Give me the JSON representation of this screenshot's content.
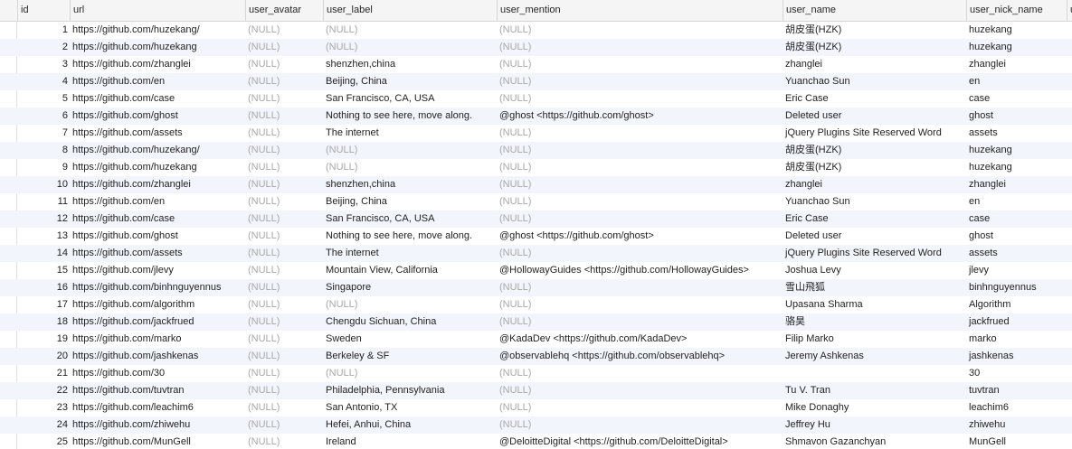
{
  "columns": [
    {
      "key": "id",
      "label": "id"
    },
    {
      "key": "url",
      "label": "url"
    },
    {
      "key": "user_avatar",
      "label": "user_avatar"
    },
    {
      "key": "user_label",
      "label": "user_label"
    },
    {
      "key": "user_mention",
      "label": "user_mention"
    },
    {
      "key": "user_name",
      "label": "user_name"
    },
    {
      "key": "user_nick_name",
      "label": "user_nick_name"
    },
    {
      "key": "extra",
      "label": "u"
    }
  ],
  "null_text": "(NULL)",
  "rows": [
    {
      "id": "1",
      "url": "https://github.com/huzekang/",
      "user_avatar": null,
      "user_label": null,
      "user_mention": null,
      "user_name": "胡皮蛋(HZK)",
      "user_nick_name": "huzekang"
    },
    {
      "id": "2",
      "url": "https://github.com/huzekang",
      "user_avatar": null,
      "user_label": null,
      "user_mention": null,
      "user_name": "胡皮蛋(HZK)",
      "user_nick_name": "huzekang"
    },
    {
      "id": "3",
      "url": "https://github.com/zhanglei",
      "user_avatar": null,
      "user_label": "shenzhen,china",
      "user_mention": null,
      "user_name": "zhanglei",
      "user_nick_name": "zhanglei"
    },
    {
      "id": "4",
      "url": "https://github.com/en",
      "user_avatar": null,
      "user_label": "Beijing, China",
      "user_mention": null,
      "user_name": "Yuanchao Sun",
      "user_nick_name": "en"
    },
    {
      "id": "5",
      "url": "https://github.com/case",
      "user_avatar": null,
      "user_label": "San Francisco, CA, USA",
      "user_mention": null,
      "user_name": "Eric Case",
      "user_nick_name": "case"
    },
    {
      "id": "6",
      "url": "https://github.com/ghost",
      "user_avatar": null,
      "user_label": "Nothing to see here, move along.",
      "user_mention": "@ghost <https://github.com/ghost>",
      "user_name": "Deleted user",
      "user_nick_name": "ghost"
    },
    {
      "id": "7",
      "url": "https://github.com/assets",
      "user_avatar": null,
      "user_label": "The internet",
      "user_mention": null,
      "user_name": "jQuery Plugins Site Reserved Word",
      "user_nick_name": "assets"
    },
    {
      "id": "8",
      "url": "https://github.com/huzekang/",
      "user_avatar": null,
      "user_label": null,
      "user_mention": null,
      "user_name": "胡皮蛋(HZK)",
      "user_nick_name": "huzekang"
    },
    {
      "id": "9",
      "url": "https://github.com/huzekang",
      "user_avatar": null,
      "user_label": null,
      "user_mention": null,
      "user_name": "胡皮蛋(HZK)",
      "user_nick_name": "huzekang"
    },
    {
      "id": "10",
      "url": "https://github.com/zhanglei",
      "user_avatar": null,
      "user_label": "shenzhen,china",
      "user_mention": null,
      "user_name": "zhanglei",
      "user_nick_name": "zhanglei"
    },
    {
      "id": "11",
      "url": "https://github.com/en",
      "user_avatar": null,
      "user_label": "Beijing, China",
      "user_mention": null,
      "user_name": "Yuanchao Sun",
      "user_nick_name": "en"
    },
    {
      "id": "12",
      "url": "https://github.com/case",
      "user_avatar": null,
      "user_label": "San Francisco, CA, USA",
      "user_mention": null,
      "user_name": "Eric Case",
      "user_nick_name": "case"
    },
    {
      "id": "13",
      "url": "https://github.com/ghost",
      "user_avatar": null,
      "user_label": "Nothing to see here, move along.",
      "user_mention": "@ghost <https://github.com/ghost>",
      "user_name": "Deleted user",
      "user_nick_name": "ghost"
    },
    {
      "id": "14",
      "url": "https://github.com/assets",
      "user_avatar": null,
      "user_label": "The internet",
      "user_mention": null,
      "user_name": "jQuery Plugins Site Reserved Word",
      "user_nick_name": "assets"
    },
    {
      "id": "15",
      "url": "https://github.com/jlevy",
      "user_avatar": null,
      "user_label": "Mountain View, California",
      "user_mention": "@HollowayGuides <https://github.com/HollowayGuides>",
      "user_name": "Joshua Levy",
      "user_nick_name": "jlevy"
    },
    {
      "id": "16",
      "url": "https://github.com/binhnguyennus",
      "user_avatar": null,
      "user_label": "Singapore",
      "user_mention": null,
      "user_name": "雪山飛狐",
      "user_nick_name": "binhnguyennus"
    },
    {
      "id": "17",
      "url": "https://github.com/algorithm",
      "user_avatar": null,
      "user_label": null,
      "user_mention": null,
      "user_name": "Upasana Sharma",
      "user_nick_name": "Algorithm"
    },
    {
      "id": "18",
      "url": "https://github.com/jackfrued",
      "user_avatar": null,
      "user_label": "Chengdu Sichuan, China",
      "user_mention": null,
      "user_name": "骆昊",
      "user_nick_name": "jackfrued"
    },
    {
      "id": "19",
      "url": "https://github.com/marko",
      "user_avatar": null,
      "user_label": "Sweden",
      "user_mention": "@KadaDev <https://github.com/KadaDev>",
      "user_name": "Filip Marko",
      "user_nick_name": "marko"
    },
    {
      "id": "20",
      "url": "https://github.com/jashkenas",
      "user_avatar": null,
      "user_label": "Berkeley & SF",
      "user_mention": "@observablehq <https://github.com/observablehq>",
      "user_name": "Jeremy Ashkenas",
      "user_nick_name": "jashkenas"
    },
    {
      "id": "21",
      "url": "https://github.com/30",
      "user_avatar": null,
      "user_label": null,
      "user_mention": null,
      "user_name": "",
      "user_nick_name": "30"
    },
    {
      "id": "22",
      "url": "https://github.com/tuvtran",
      "user_avatar": null,
      "user_label": "Philadelphia, Pennsylvania",
      "user_mention": null,
      "user_name": "Tu V. Tran",
      "user_nick_name": "tuvtran"
    },
    {
      "id": "23",
      "url": "https://github.com/leachim6",
      "user_avatar": null,
      "user_label": "San Antonio, TX",
      "user_mention": null,
      "user_name": "Mike Donaghy",
      "user_nick_name": "leachim6"
    },
    {
      "id": "24",
      "url": "https://github.com/zhiwehu",
      "user_avatar": null,
      "user_label": "Hefei, Anhui, China",
      "user_mention": null,
      "user_name": "Jeffrey Hu",
      "user_nick_name": "zhiwehu"
    },
    {
      "id": "25",
      "url": "https://github.com/MunGell",
      "user_avatar": null,
      "user_label": "Ireland",
      "user_mention": "@DeloitteDigital <https://github.com/DeloitteDigital>",
      "user_name": "Shmavon Gazanchyan",
      "user_nick_name": "MunGell"
    }
  ]
}
